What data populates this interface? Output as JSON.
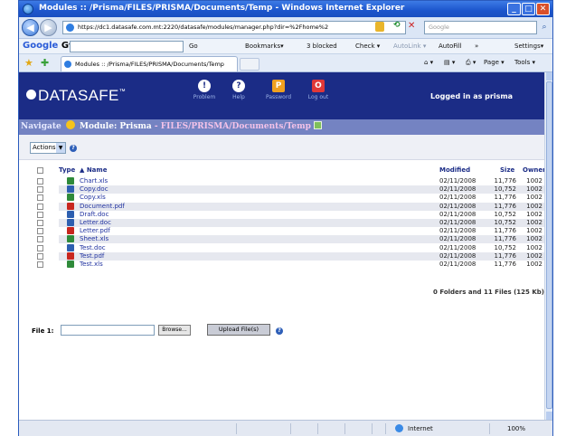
{
  "window": {
    "title": "Modules :: /Prisma/FILES/PRISMA/Documents/Temp - Windows Internet Explorer",
    "min": "_",
    "max": "□",
    "close": "✕"
  },
  "address": {
    "url": "https://dc1.datasafe.com.mt:2220/datasafe/modules/manager.php?dir=%2Fhome%2",
    "search_placeholder": "Google"
  },
  "gtoolbar": {
    "logo": "Google",
    "g_suffix": "G▾",
    "go": "Go",
    "bookmarks": "Bookmarks▾",
    "blocked": "3 blocked",
    "check": "Check ▾",
    "autolink": "AutoLink ▾",
    "autofill": "AutoFill",
    "more": "»",
    "settings": "Settings▾"
  },
  "tabs": {
    "active_tab": "Modules :: /Prisma/FILES/PRISMA/Documents/Temp",
    "page": "Page ▾",
    "tools": "Tools ▾"
  },
  "app": {
    "logo": "DATASAFE",
    "trademark": "™",
    "header_icons": [
      {
        "name": "problem",
        "label": "Problem",
        "glyph": "!"
      },
      {
        "name": "help",
        "label": "Help",
        "glyph": "?"
      },
      {
        "name": "password",
        "label": "Password",
        "glyph": "P"
      },
      {
        "name": "logout",
        "label": "Log out",
        "glyph": "O"
      }
    ],
    "logged_in": "Logged in as prisma"
  },
  "navigate": {
    "label": "Navigate",
    "module": "Module: Prisma",
    "crumbs": [
      "- FILES",
      "/PRISMA",
      "/Documents",
      "/Temp"
    ]
  },
  "actions": {
    "label": "Actions:"
  },
  "table": {
    "headers": {
      "type": "Type",
      "name": "▲ Name",
      "modified": "Modified",
      "size": "Size",
      "owner": "Owner"
    },
    "rows": [
      {
        "icon": "xls",
        "name": "Chart.xls",
        "modified": "02/11/2008",
        "size": "11,776",
        "owner": "1002"
      },
      {
        "icon": "doc",
        "name": "Copy.doc",
        "modified": "02/11/2008",
        "size": "10,752",
        "owner": "1002"
      },
      {
        "icon": "xls",
        "name": "Copy.xls",
        "modified": "02/11/2008",
        "size": "11,776",
        "owner": "1002"
      },
      {
        "icon": "pdf",
        "name": "Document.pdf",
        "modified": "02/11/2008",
        "size": "11,776",
        "owner": "1002"
      },
      {
        "icon": "doc",
        "name": "Draft.doc",
        "modified": "02/11/2008",
        "size": "10,752",
        "owner": "1002"
      },
      {
        "icon": "doc",
        "name": "Letter.doc",
        "modified": "02/11/2008",
        "size": "10,752",
        "owner": "1002"
      },
      {
        "icon": "pdf",
        "name": "Letter.pdf",
        "modified": "02/11/2008",
        "size": "11,776",
        "owner": "1002"
      },
      {
        "icon": "xls",
        "name": "Sheet.xls",
        "modified": "02/11/2008",
        "size": "11,776",
        "owner": "1002"
      },
      {
        "icon": "doc",
        "name": "Test.doc",
        "modified": "02/11/2008",
        "size": "10,752",
        "owner": "1002"
      },
      {
        "icon": "pdf",
        "name": "Test.pdf",
        "modified": "02/11/2008",
        "size": "11,776",
        "owner": "1002"
      },
      {
        "icon": "xls",
        "name": "Test.xls",
        "modified": "02/11/2008",
        "size": "11,776",
        "owner": "1002"
      }
    ],
    "summary": "0 Folders and 11 Files (125 Kb)"
  },
  "upload": {
    "label": "File 1:",
    "browse": "Browse...",
    "button": "Upload File(s)"
  },
  "status": {
    "zone": "Internet",
    "zoom": "100%"
  }
}
